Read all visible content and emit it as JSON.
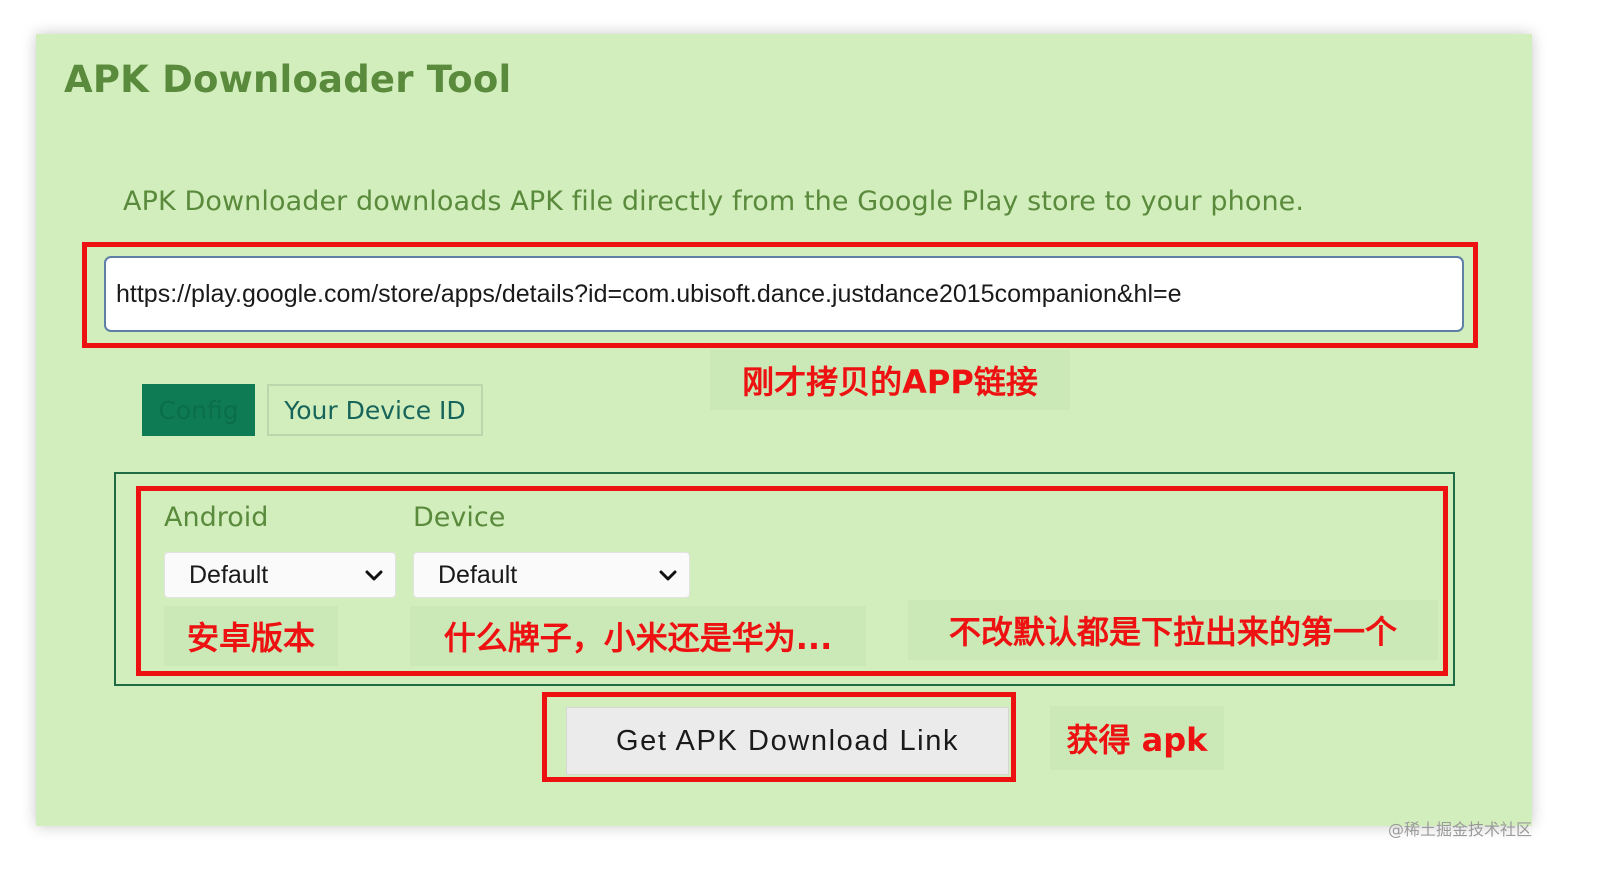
{
  "header": {
    "title": "APK Downloader Tool",
    "description": "APK Downloader downloads APK file directly from the Google Play store to your phone."
  },
  "url_input": {
    "value": "https://play.google.com/store/apps/details?id=com.ubisoft.dance.justdance2015companion&hl=e"
  },
  "tabs": [
    {
      "label": "Config",
      "active": true
    },
    {
      "label": "Your Device ID",
      "active": false
    }
  ],
  "config": {
    "android_label": "Android",
    "android_value": "Default",
    "device_label": "Device",
    "device_value": "Default"
  },
  "actions": {
    "get_link_label": "Get APK Download Link"
  },
  "annotations": {
    "url_note": "刚才拷贝的APP链接",
    "android_note": "安卓版本",
    "device_note": "什么牌子，小米还是华为...",
    "default_note": "不改默认都是下拉出来的第一个",
    "button_note": "获得 apk"
  },
  "watermark": "@稀土掘金技术社区",
  "colors": {
    "panel_bg": "#d2eebd",
    "heading_green": "#5a8a3c",
    "tab_active_bg": "#0e7b55",
    "annotation_red": "#ee1111"
  }
}
